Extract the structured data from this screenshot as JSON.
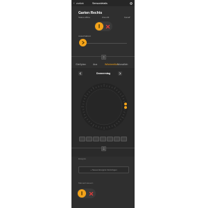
{
  "nav": {
    "back_label": "zurück",
    "title": "Sensordetails",
    "settings_icon": "gear-icon"
  },
  "device": {
    "name": "Garten Rechts",
    "meta": [
      {
        "label": "Status",
        "value": "offline"
      },
      {
        "label": "Zone",
        "value": "03"
      },
      {
        "label": "Kanal",
        "value": "7"
      }
    ]
  },
  "toggle1": {
    "state": "on"
  },
  "slider": {
    "label": "Ausschaltzeit",
    "value_fraction": 0.0
  },
  "tabs": {
    "items": [
      "Gießplan",
      "Aus",
      "Wöchentlich",
      "Monatlich"
    ],
    "active_index": 2
  },
  "day": {
    "label": "Donnerstag"
  },
  "clock": {
    "marker_fraction": 0.24
  },
  "weekday_chip_count": 7,
  "section2": {
    "header": "Ereignis",
    "button_label": "+ Neues Ereignis hinzufügen"
  },
  "footer": {
    "label": "Manuell steuern"
  },
  "colors": {
    "accent": "#f3a31a",
    "danger": "#e33b3b",
    "panel": "#2f2f2f",
    "section": "#2a2a2a",
    "topbar": "#262626"
  }
}
